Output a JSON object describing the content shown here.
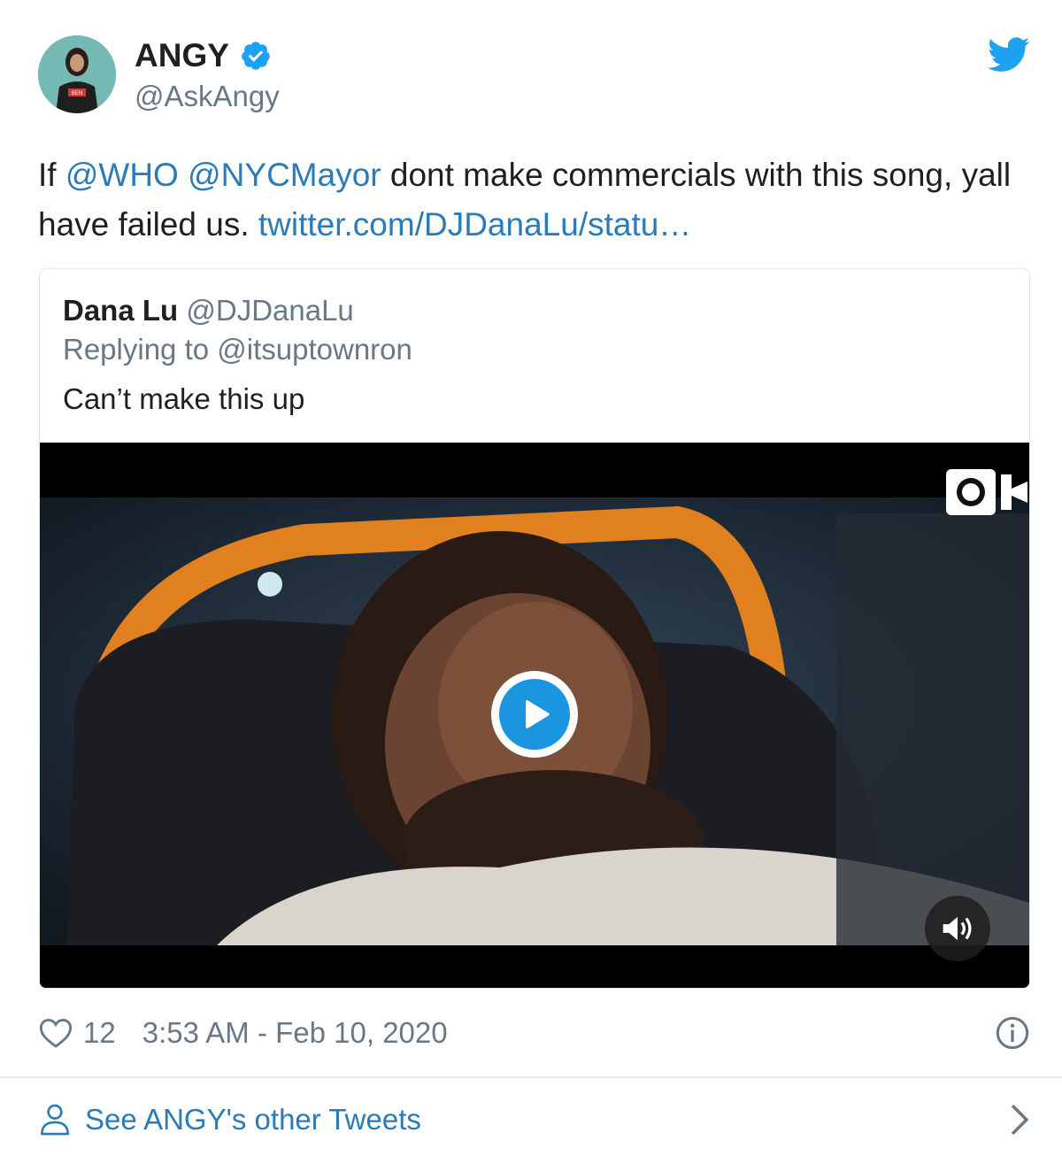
{
  "author": {
    "name": "ANGY",
    "handle": "@AskAngy",
    "verified": true,
    "avatar_shirt_text": "BEN"
  },
  "tweet": {
    "prefix": "If ",
    "mention1": "@WHO",
    "space": " ",
    "mention2": "@NYCMayor",
    "body": " dont make commercials with this song, yall have failed us. ",
    "link": "twitter.com/DJDanaLu/statu…"
  },
  "quote": {
    "name": "Dana Lu",
    "handle": "@DJDanaLu",
    "reply_context": "Replying to @itsuptownron",
    "text": "Can’t make this up"
  },
  "video": {
    "play_icon": "play-icon",
    "camera_icon": "camera-icon",
    "volume_icon": "volume-icon"
  },
  "meta": {
    "likes": "12",
    "timestamp": "3:53 AM - Feb 10, 2020"
  },
  "footer": {
    "label": "See ANGY's other Tweets"
  },
  "colors": {
    "link": "#2b7bb9",
    "brand": "#1da1f2",
    "verified": "#1da1f2",
    "muted": "#697882"
  }
}
